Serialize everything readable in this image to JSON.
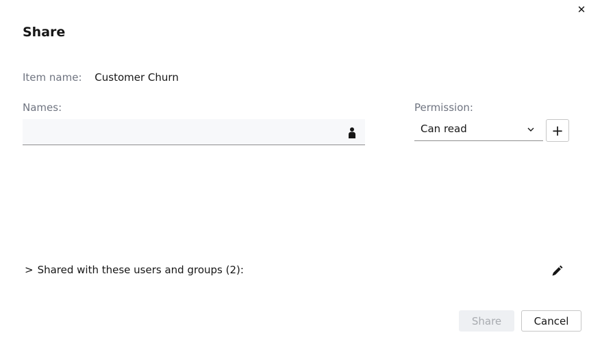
{
  "dialog": {
    "title": "Share",
    "close_glyph": "✕"
  },
  "item": {
    "label": "Item name:",
    "value": "Customer Churn"
  },
  "names": {
    "label": "Names:",
    "value": "",
    "icon": "person-icon"
  },
  "permission": {
    "label": "Permission:",
    "selected": "Can read",
    "icon": "chevron-down-icon"
  },
  "add_button": {
    "glyph": "+"
  },
  "shared": {
    "caret": ">",
    "label": "Shared with these users and groups (2):",
    "edit_icon": "pencil-icon"
  },
  "footer": {
    "share_label": "Share",
    "cancel_label": "Cancel"
  }
}
